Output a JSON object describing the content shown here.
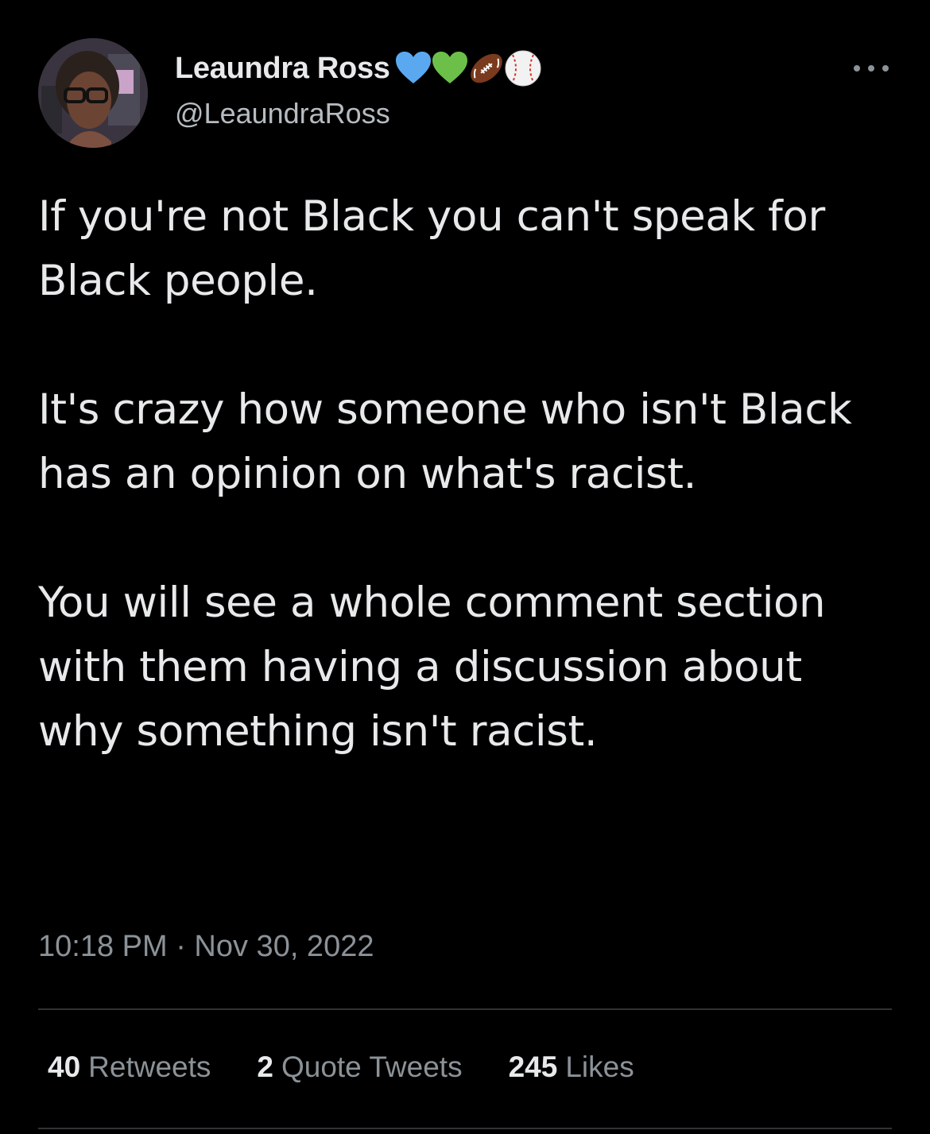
{
  "author": {
    "display_name": "Leaundra Ross",
    "handle": "@LeaundraRoss",
    "name_emojis": [
      "blue-heart",
      "green-heart",
      "american-football",
      "baseball"
    ]
  },
  "tweet": {
    "paragraphs": [
      "If you're not Black you can't speak for Black people.",
      "It's crazy how someone who isn't Black has an opinion on what's racist.",
      "You will see a whole comment section with them having a discussion about why something isn't racist."
    ],
    "timestamp": "10:18 PM · Nov 30, 2022"
  },
  "stats": {
    "retweets_count": "40",
    "retweets_label": "Retweets",
    "quotes_count": "2",
    "quotes_label": "Quote Tweets",
    "likes_count": "245",
    "likes_label": "Likes"
  },
  "colors": {
    "background": "#000000",
    "primary_text": "#e7e9ea",
    "secondary_text": "#8b9298",
    "divider": "#2f3336",
    "blue_heart": "#5aa9f0",
    "green_heart": "#6cc04a"
  }
}
